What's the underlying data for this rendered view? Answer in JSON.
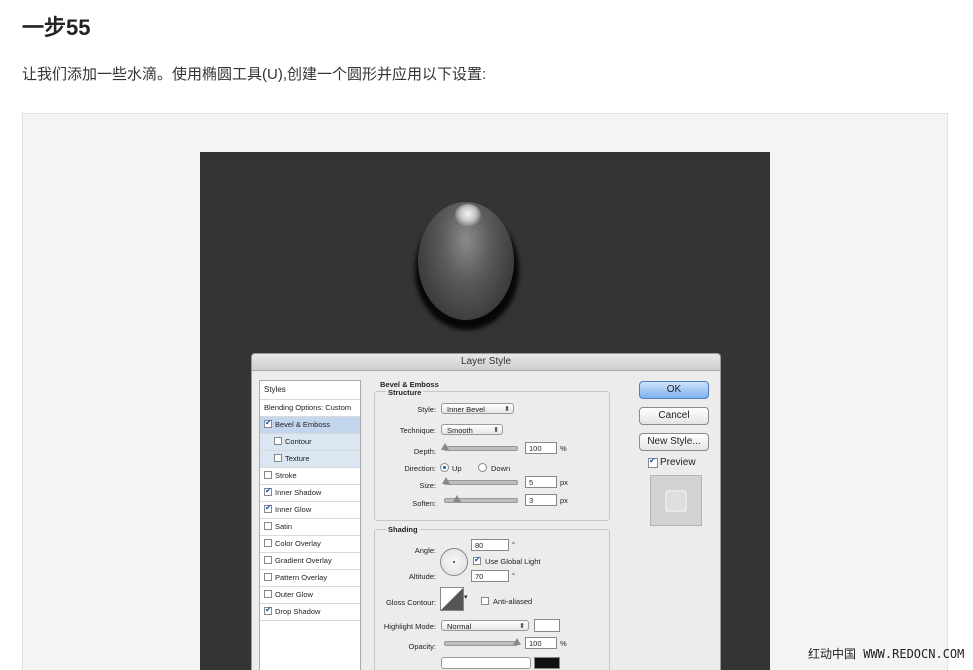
{
  "article": {
    "heading": "一步55",
    "intro": "让我们添加一些水滴。使用椭圆工具(U),创建一个圆形并应用以下设置:"
  },
  "dialog": {
    "title": "Layer Style",
    "styles_header": "Styles",
    "styles": [
      {
        "label": "Blending Options: Custom",
        "checkbox": false,
        "checked": false
      },
      {
        "label": "Bevel & Emboss",
        "checkbox": true,
        "checked": true
      },
      {
        "label": "Contour",
        "checkbox": true,
        "checked": false
      },
      {
        "label": "Texture",
        "checkbox": true,
        "checked": false
      },
      {
        "label": "Stroke",
        "checkbox": true,
        "checked": false
      },
      {
        "label": "Inner Shadow",
        "checkbox": true,
        "checked": true
      },
      {
        "label": "Inner Glow",
        "checkbox": true,
        "checked": true
      },
      {
        "label": "Satin",
        "checkbox": true,
        "checked": false
      },
      {
        "label": "Color Overlay",
        "checkbox": true,
        "checked": false
      },
      {
        "label": "Gradient Overlay",
        "checkbox": true,
        "checked": false
      },
      {
        "label": "Pattern Overlay",
        "checkbox": true,
        "checked": false
      },
      {
        "label": "Outer Glow",
        "checkbox": true,
        "checked": false
      },
      {
        "label": "Drop Shadow",
        "checkbox": true,
        "checked": true
      }
    ],
    "bevel_title": "Bevel & Emboss",
    "structure_title": "Structure",
    "style_label": "Style:",
    "style_value": "Inner Bevel",
    "technique_label": "Technique:",
    "technique_value": "Smooth",
    "depth_label": "Depth:",
    "depth_value": "100",
    "depth_unit": "%",
    "direction_label": "Direction:",
    "direction_up": "Up",
    "direction_down": "Down",
    "direction_selected": "Up",
    "size_label": "Size:",
    "size_value": "5",
    "size_unit": "px",
    "soften_label": "Soften:",
    "soften_value": "3",
    "soften_unit": "px",
    "shading_title": "Shading",
    "angle_label": "Angle:",
    "angle_value": "80",
    "angle_unit": "°",
    "global_light_label": "Use Global Light",
    "global_light_checked": true,
    "altitude_label": "Altitude:",
    "altitude_value": "70",
    "altitude_unit": "°",
    "gloss_label": "Gloss Contour:",
    "anti_aliased_label": "Anti-aliased",
    "anti_aliased_checked": false,
    "highlight_mode_label": "Highlight Mode:",
    "highlight_mode_value": "Normal",
    "highlight_color": "#ffffff",
    "opacity_label": "Opacity:",
    "opacity_value": "100",
    "opacity_unit": "%",
    "depth_slider": 0.0,
    "size_slider": 0.02,
    "soften_slider": 0.17,
    "opacity_slider": 1.0,
    "ok_label": "OK",
    "cancel_label": "Cancel",
    "new_style_label": "New Style...",
    "preview_label": "Preview",
    "preview_checked": true
  },
  "watermark": "红动中国 WWW.REDOCN.COM"
}
